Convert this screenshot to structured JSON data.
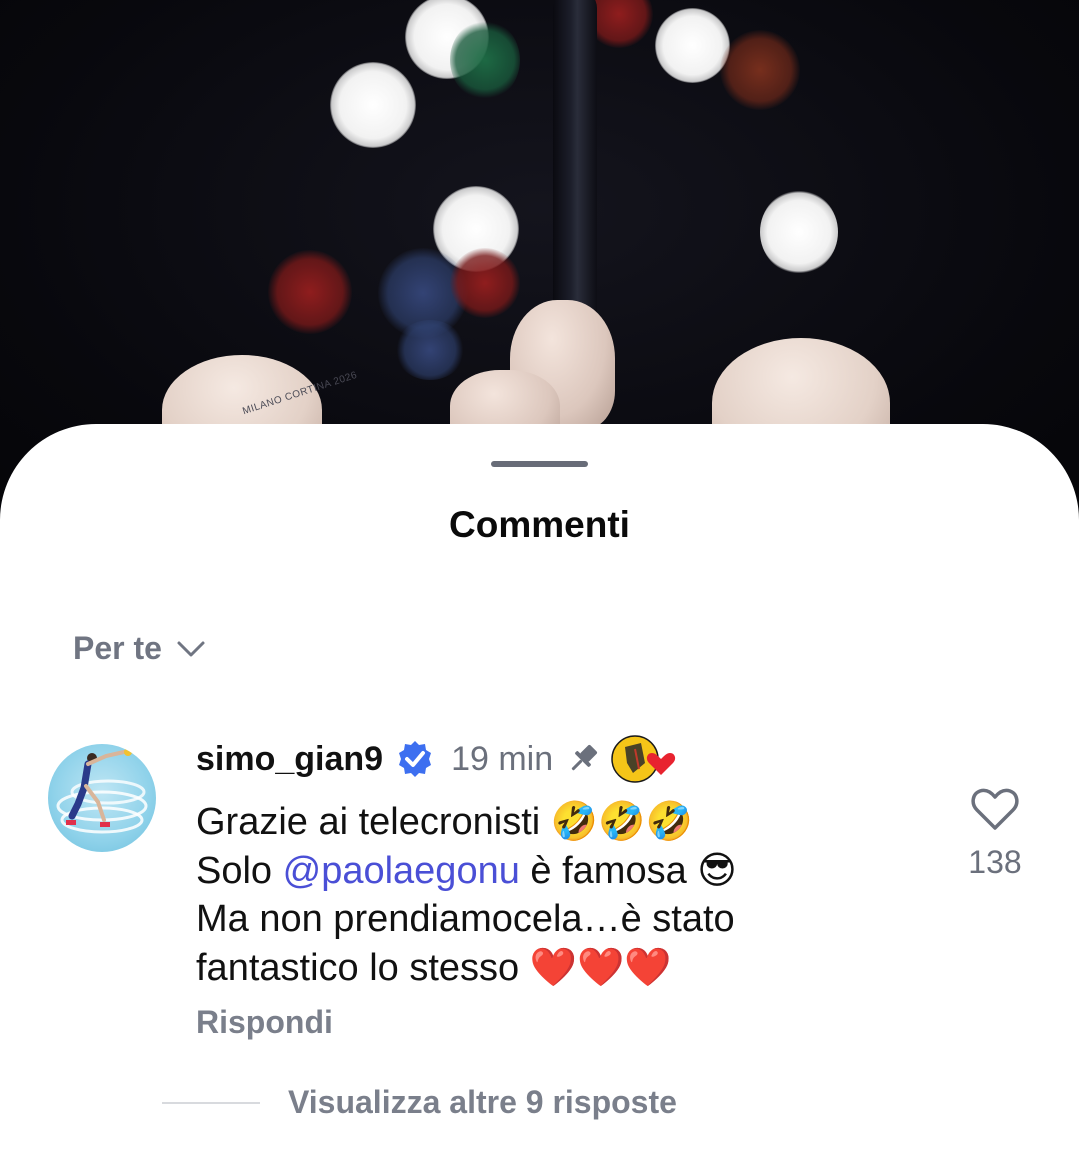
{
  "sheet": {
    "title": "Commenti",
    "filter_label": "Per te"
  },
  "comment": {
    "username": "simo_gian9",
    "verified": true,
    "timestamp": "19 min",
    "pinned": true,
    "lines": [
      {
        "before": "Grazie ai telecronisti ",
        "emoji": "🤣🤣🤣"
      },
      {
        "before": "Solo ",
        "mention": "@paolaegonu",
        "after": " è famosa ",
        "emoji": "😎"
      },
      {
        "before": "Ma non prendiamocela…è stato"
      },
      {
        "before": "fantastico lo stesso ",
        "emoji": "❤️❤️❤️"
      }
    ],
    "like_count": "138",
    "reply_label": "Rispondi",
    "more_replies_label": "Visualizza altre 9 risposte"
  },
  "background": {
    "beanie_text": "MILANO CORTINA 2026"
  },
  "colors": {
    "mention": "#4a4fd6",
    "verified_badge": "#3d6ff0",
    "creator_heart": "#e8232f",
    "secondary_text": "#6b707c"
  }
}
